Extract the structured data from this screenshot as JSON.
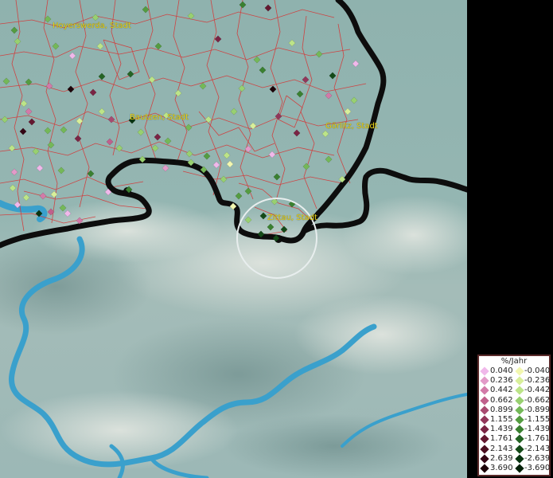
{
  "map": {
    "place_labels": [
      {
        "name": "Hoyerswerda, Stadt"
      },
      {
        "name": "Bautzen, Stadt"
      },
      {
        "name": "Görlitz, Stadt"
      },
      {
        "name": "Zittau, Stadt"
      }
    ],
    "selected_place": "Zittau, Stadt"
  },
  "legend": {
    "title": "%/Jahr",
    "positive": [
      {
        "label": "0.040",
        "color": "#f0b8ea"
      },
      {
        "label": "0.236",
        "color": "#e29ac8"
      },
      {
        "label": "0.442",
        "color": "#d27aa8"
      },
      {
        "label": "0.662",
        "color": "#c0608c"
      },
      {
        "label": "0.899",
        "color": "#a84a70"
      },
      {
        "label": "1.155",
        "color": "#92365a"
      },
      {
        "label": "1.439",
        "color": "#7a2444"
      },
      {
        "label": "1.761",
        "color": "#641830"
      },
      {
        "label": "2.143",
        "color": "#4c0e20"
      },
      {
        "label": "2.639",
        "color": "#340614"
      },
      {
        "label": "3.690",
        "color": "#1c0208"
      }
    ],
    "negative": [
      {
        "label": "-0.040",
        "color": "#f2f7b0"
      },
      {
        "label": "-0.236",
        "color": "#d8ef9a"
      },
      {
        "label": "-0.442",
        "color": "#bce488"
      },
      {
        "label": "-0.662",
        "color": "#98d070"
      },
      {
        "label": "-0.899",
        "color": "#74b858"
      },
      {
        "label": "-1.155",
        "color": "#549c40"
      },
      {
        "label": "-1.439",
        "color": "#3a8030"
      },
      {
        "label": "-1.761",
        "color": "#246424"
      },
      {
        "label": "-2.143",
        "color": "#144a18"
      },
      {
        "label": "-2.639",
        "color": "#083410"
      },
      {
        "label": "-3.690",
        "color": "#022008"
      }
    ]
  },
  "colors": {
    "land": "#8fb2ae",
    "mountains": "#c8d2cc",
    "border": "#0d0d0d",
    "municipal_lines": "#d83030",
    "rivers": "#3aa0cc",
    "label": "#e8d21a"
  }
}
